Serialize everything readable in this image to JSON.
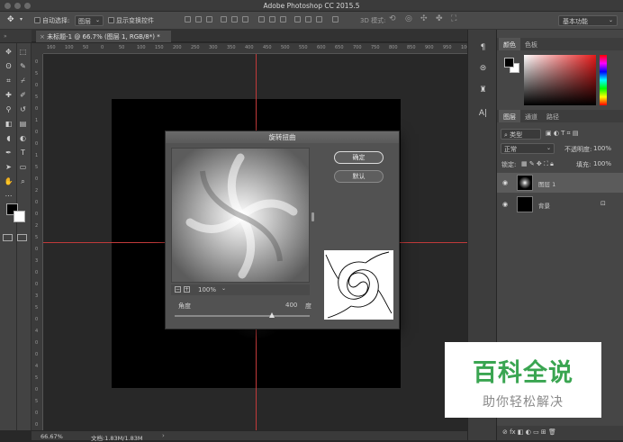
{
  "window": {
    "title": "Adobe Photoshop CC 2015.5"
  },
  "options_bar": {
    "auto_select_label": "自动选择:",
    "auto_select_value": "图层",
    "show_transform_label": "显示变换控件",
    "mode_3d_label": "3D 模式:",
    "workspace": "基本功能"
  },
  "document": {
    "tab_label": "未标题-1 @ 66.7% (图层 1, RGB/8*) *",
    "ruler_ticks": [
      "160",
      "100",
      "50",
      "0",
      "50",
      "100",
      "150",
      "200",
      "250",
      "300",
      "350",
      "400",
      "450",
      "500",
      "550",
      "600",
      "650",
      "700",
      "750",
      "800",
      "850",
      "900",
      "950",
      "1000"
    ],
    "ruler_left_ticks": [
      "0",
      "5",
      "0",
      "5",
      "0",
      "1",
      "0",
      "0",
      "1",
      "5",
      "0",
      "2",
      "0",
      "0",
      "2",
      "5",
      "0",
      "3",
      "0",
      "0",
      "3",
      "5",
      "0",
      "4",
      "0",
      "0",
      "4",
      "5",
      "0",
      "5",
      "0",
      "0"
    ]
  },
  "status_bar": {
    "zoom": "66.67%",
    "doc_info": "文档:1.83M/1.83M"
  },
  "dialog": {
    "title": "旋转扭曲",
    "ok_label": "确定",
    "default_label": "默认",
    "zoom_value": "100%",
    "angle_label": "角度",
    "angle_value": "400",
    "angle_unit": "度",
    "angle_slider_fraction": 0.72
  },
  "color_panel": {
    "tab_color": "颜色",
    "tab_swatches": "色板"
  },
  "layers_panel": {
    "tab_layers": "图层",
    "tab_channels": "通道",
    "tab_paths": "路径",
    "filter_kind": "类型",
    "blend_mode": "正常",
    "opacity_label": "不透明度:",
    "opacity_value": "100%",
    "lock_label": "锁定:",
    "fill_label": "填充:",
    "fill_value": "100%",
    "layers": [
      {
        "name": "图层 1",
        "selected": true
      },
      {
        "name": "背景",
        "selected": false
      }
    ]
  },
  "watermark": {
    "line1": "百科全说",
    "line2": "助你轻松解决"
  },
  "colors": {
    "accent_green": "#3aa551",
    "guide_red": "#c13a3a"
  }
}
